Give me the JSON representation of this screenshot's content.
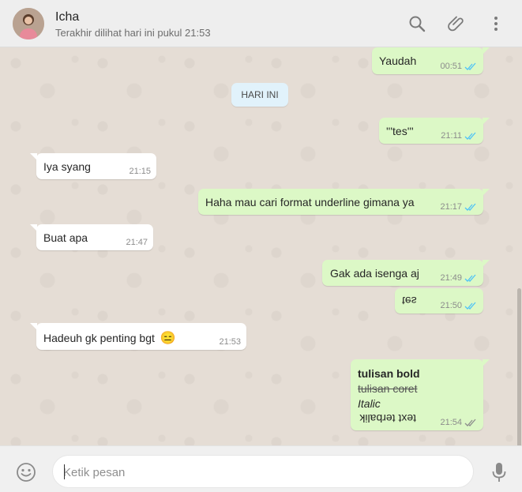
{
  "header": {
    "name": "Icha",
    "status": "Terakhir dilihat hari ini pukul 21:53",
    "icons": [
      "search-icon",
      "attach-icon",
      "menu-icon"
    ]
  },
  "date_divider": "HARI INI",
  "messages": [
    {
      "dir": "out",
      "text": "Yaudah",
      "time": "00:51",
      "ticks": "read"
    },
    {
      "dir": "out",
      "text": "'''tes'''",
      "time": "21:11",
      "ticks": "read"
    },
    {
      "dir": "in",
      "text": "Iya syang",
      "time": "21:15"
    },
    {
      "dir": "out",
      "text": "Haha mau cari format underline gimana ya",
      "time": "21:17",
      "ticks": "read"
    },
    {
      "dir": "in",
      "text": "Buat apa",
      "time": "21:47"
    },
    {
      "dir": "out",
      "text": "Gak ada isenga aj",
      "time": "21:49",
      "ticks": "read"
    },
    {
      "dir": "out",
      "text": "tes",
      "time": "21:50",
      "ticks": "read"
    },
    {
      "dir": "in",
      "text": "Hadeuh gk penting bgt",
      "emoji": "😑",
      "time": "21:53"
    },
    {
      "dir": "out",
      "line_bold": "tulisan bold",
      "line_strike": "tulisan coret",
      "line_italic": "Italic",
      "line_flipped": "text terbalik",
      "time": "21:54",
      "ticks": "delivered"
    }
  ],
  "composer": {
    "placeholder": "Ketik pesan",
    "icons": [
      "emoji-icon",
      "mic-icon"
    ]
  },
  "colors": {
    "outgoing_bubble": "#dcf8c6",
    "incoming_bubble": "#ffffff",
    "chat_background": "#e5ddd5",
    "read_ticks": "#4fc3f7",
    "delivered_ticks": "#8c8c8c"
  }
}
